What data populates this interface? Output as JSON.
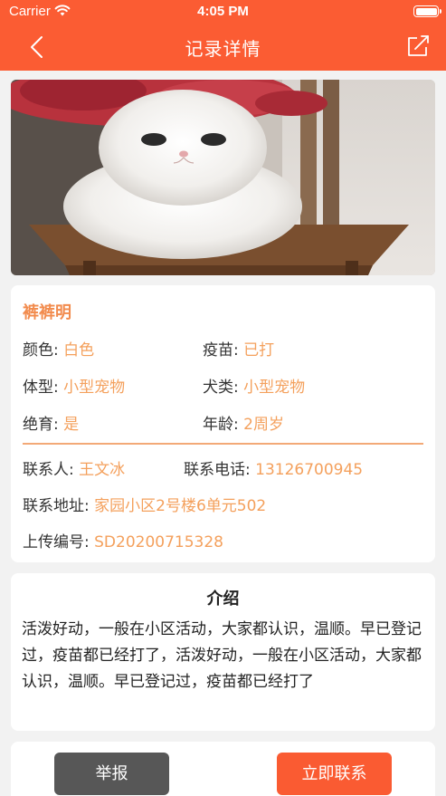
{
  "status_bar": {
    "carrier": "Carrier",
    "time": "4:05 PM"
  },
  "nav": {
    "title": "记录详情",
    "back_icon": "chevron-left-icon",
    "share_icon": "share-icon"
  },
  "pet": {
    "name": "裤裤明",
    "fields": [
      {
        "label": "颜色:",
        "value": "白色"
      },
      {
        "label": "疫苗:",
        "value": "已打"
      },
      {
        "label": "体型:",
        "value": "小型宠物"
      },
      {
        "label": "犬类:",
        "value": "小型宠物"
      },
      {
        "label": "绝育:",
        "value": "是"
      },
      {
        "label": "年龄:",
        "value": "2周岁"
      }
    ],
    "contact": [
      {
        "label": "联系人:",
        "value": "王文冰"
      },
      {
        "label": "联系电话:",
        "value": "13126700945"
      },
      {
        "label": "联系地址:",
        "value": "家园小区2号楼6单元502"
      },
      {
        "label": "上传编号:",
        "value": "SD20200715328"
      }
    ]
  },
  "intro": {
    "title": "介绍",
    "text": "活泼好动，一般在小区活动，大家都认识，温顺。早已登记过，疫苗都已经打了，活泼好动，一般在小区活动，大家都认识，温顺。早已登记过，疫苗都已经打了"
  },
  "actions": {
    "report_label": "举报",
    "contact_label": "立即联系"
  },
  "colors": {
    "brand": "#fb5c33",
    "value_text": "#f4a05c",
    "report_button": "#575757"
  }
}
